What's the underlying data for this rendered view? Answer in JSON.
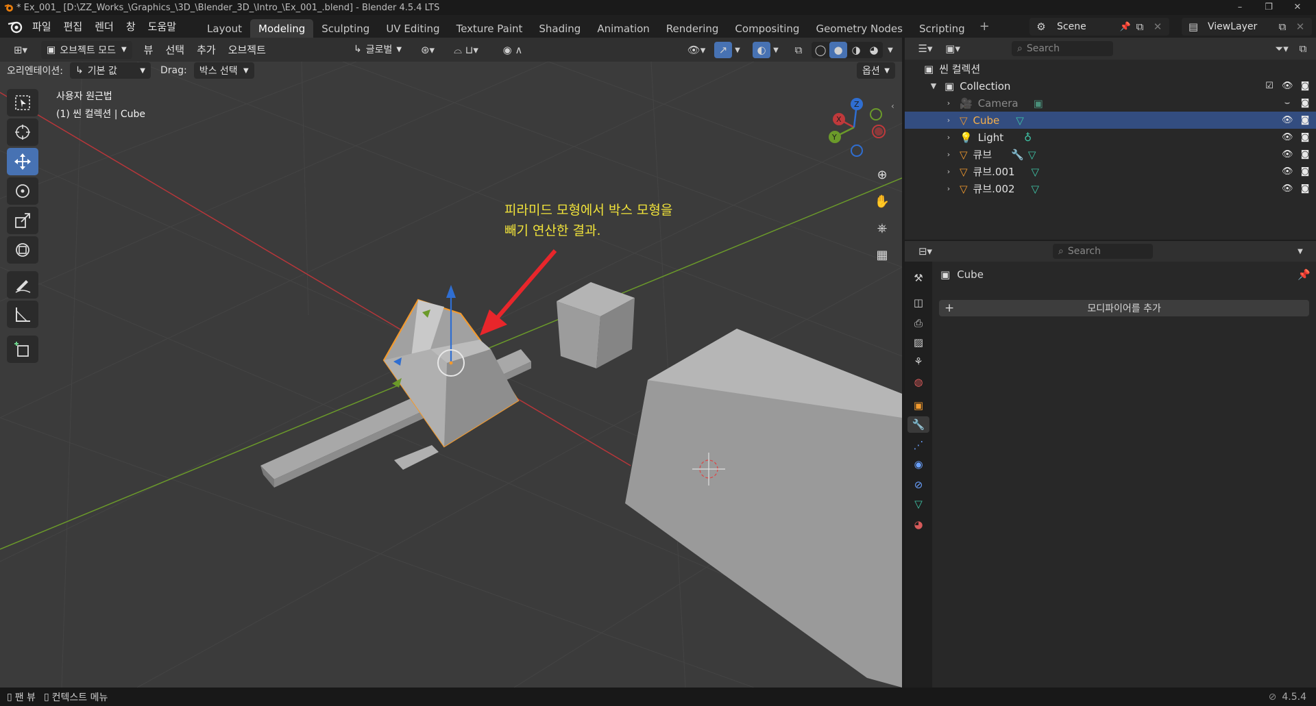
{
  "window": {
    "title": "* Ex_001_ [D:\\ZZ_Works_\\Graphics_\\3D_\\Blender_3D_\\Intro_\\Ex_001_.blend] - Blender 4.5.4 LTS",
    "min": "–",
    "max": "❐",
    "close": "✕"
  },
  "menu": {
    "items": [
      "파일",
      "편집",
      "렌더",
      "창",
      "도움말"
    ],
    "tabs": [
      "Layout",
      "Modeling",
      "Sculpting",
      "UV Editing",
      "Texture Paint",
      "Shading",
      "Animation",
      "Rendering",
      "Compositing",
      "Geometry Nodes",
      "Scripting"
    ],
    "active_tab": "Modeling",
    "add_tab": "+",
    "scene_label": "Scene",
    "viewlayer_label": "ViewLayer"
  },
  "viewport_header": {
    "mode": "오브젝트 모드",
    "menus": [
      "뷰",
      "선택",
      "추가",
      "오브젝트"
    ],
    "transform_orientation": "글로벌"
  },
  "tool_settings": {
    "orientation_label": "오리엔테이션:",
    "orientation_value": "기본 값",
    "drag_label": "Drag:",
    "drag_value": "박스 선택",
    "options": "옵션"
  },
  "viewport": {
    "view_name": "사용자 원근법",
    "collection_info": "(1) 씬 컬렉션 | Cube",
    "annotation_line1": "피라미드 모형에서 박스 모형을",
    "annotation_line2": "빼기 연산한 결과.",
    "gizmo_axes": [
      "X",
      "Y",
      "Z"
    ],
    "colors": {
      "x_axis": "#c0393b",
      "y_axis": "#6e9e2c",
      "z_axis": "#2f6ed1",
      "selection": "#f29a2e",
      "annotation": "#f1e33a",
      "arrow": "#e8262b"
    }
  },
  "outliner": {
    "search_placeholder": "Search",
    "root": "씬 컬렉션",
    "collection": "Collection",
    "items": [
      {
        "name": "Camera"
      },
      {
        "name": "Cube"
      },
      {
        "name": "Light"
      },
      {
        "name": "큐브"
      },
      {
        "name": "큐브.001"
      },
      {
        "name": "큐브.002"
      }
    ]
  },
  "properties": {
    "search_placeholder": "Search",
    "object_name": "Cube",
    "add_modifier": "모디파이어를 추가",
    "add_icon": "+"
  },
  "status": {
    "pan": "팬 뷰",
    "context": "컨텍스트 메뉴",
    "version": "4.5.4"
  }
}
